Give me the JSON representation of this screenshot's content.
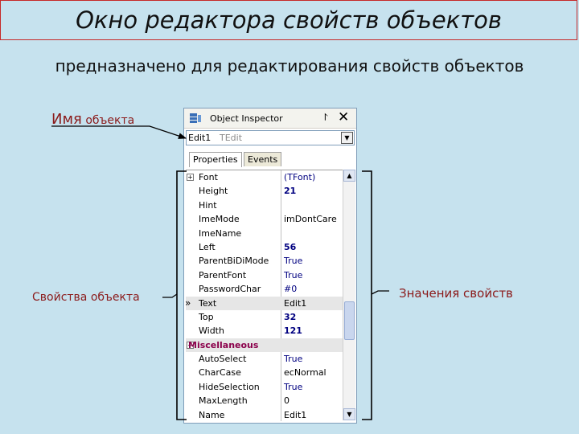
{
  "slide": {
    "title": "Окно редактора свойств объектов",
    "subtitle": "предназначено для редактирования свойств объектов"
  },
  "callouts": {
    "object_name_big": "Имя",
    "object_name_small": " объекта",
    "properties": "Свойства объекта",
    "values": "Значения свойств"
  },
  "inspector": {
    "title": "Object Inspector",
    "icons": {
      "title": "object-inspector-icon",
      "pin": "pin-icon",
      "close": "close-icon"
    },
    "combo": {
      "name": "Edit1",
      "type": "TEdit"
    },
    "tabs": {
      "properties": "Properties",
      "events": "Events"
    },
    "rows": [
      {
        "name": "Font",
        "value": "(TFont)",
        "expander": "+",
        "style": "plain"
      },
      {
        "name": "Height",
        "value": "21",
        "style": "bold"
      },
      {
        "name": "Hint",
        "value": "",
        "style": "plain"
      },
      {
        "name": "ImeMode",
        "value": "imDontCare",
        "style": "normal"
      },
      {
        "name": "ImeName",
        "value": "",
        "style": "plain"
      },
      {
        "name": "Left",
        "value": "56",
        "style": "bold"
      },
      {
        "name": "ParentBiDiMode",
        "value": "True",
        "style": "plain"
      },
      {
        "name": "ParentFont",
        "value": "True",
        "style": "plain"
      },
      {
        "name": "PasswordChar",
        "value": "#0",
        "style": "plain"
      },
      {
        "name": "Text",
        "value": "Edit1",
        "style": "normal",
        "selected": true
      },
      {
        "name": "Top",
        "value": "32",
        "style": "bold"
      },
      {
        "name": "Width",
        "value": "121",
        "style": "bold"
      },
      {
        "name": "Miscellaneous",
        "value": "",
        "expander": "−",
        "category": true
      },
      {
        "name": "AutoSelect",
        "value": "True",
        "style": "plain"
      },
      {
        "name": "CharCase",
        "value": "ecNormal",
        "style": "normal"
      },
      {
        "name": "HideSelection",
        "value": "True",
        "style": "plain"
      },
      {
        "name": "MaxLength",
        "value": "0",
        "style": "normal"
      },
      {
        "name": "Name",
        "value": "Edit1",
        "style": "normal"
      }
    ]
  },
  "colors": {
    "background": "#c6e2ee",
    "title_border": "#c62828",
    "callout_text": "#8b1a1a",
    "category_text": "#8b004b",
    "value_text": "#000080"
  }
}
